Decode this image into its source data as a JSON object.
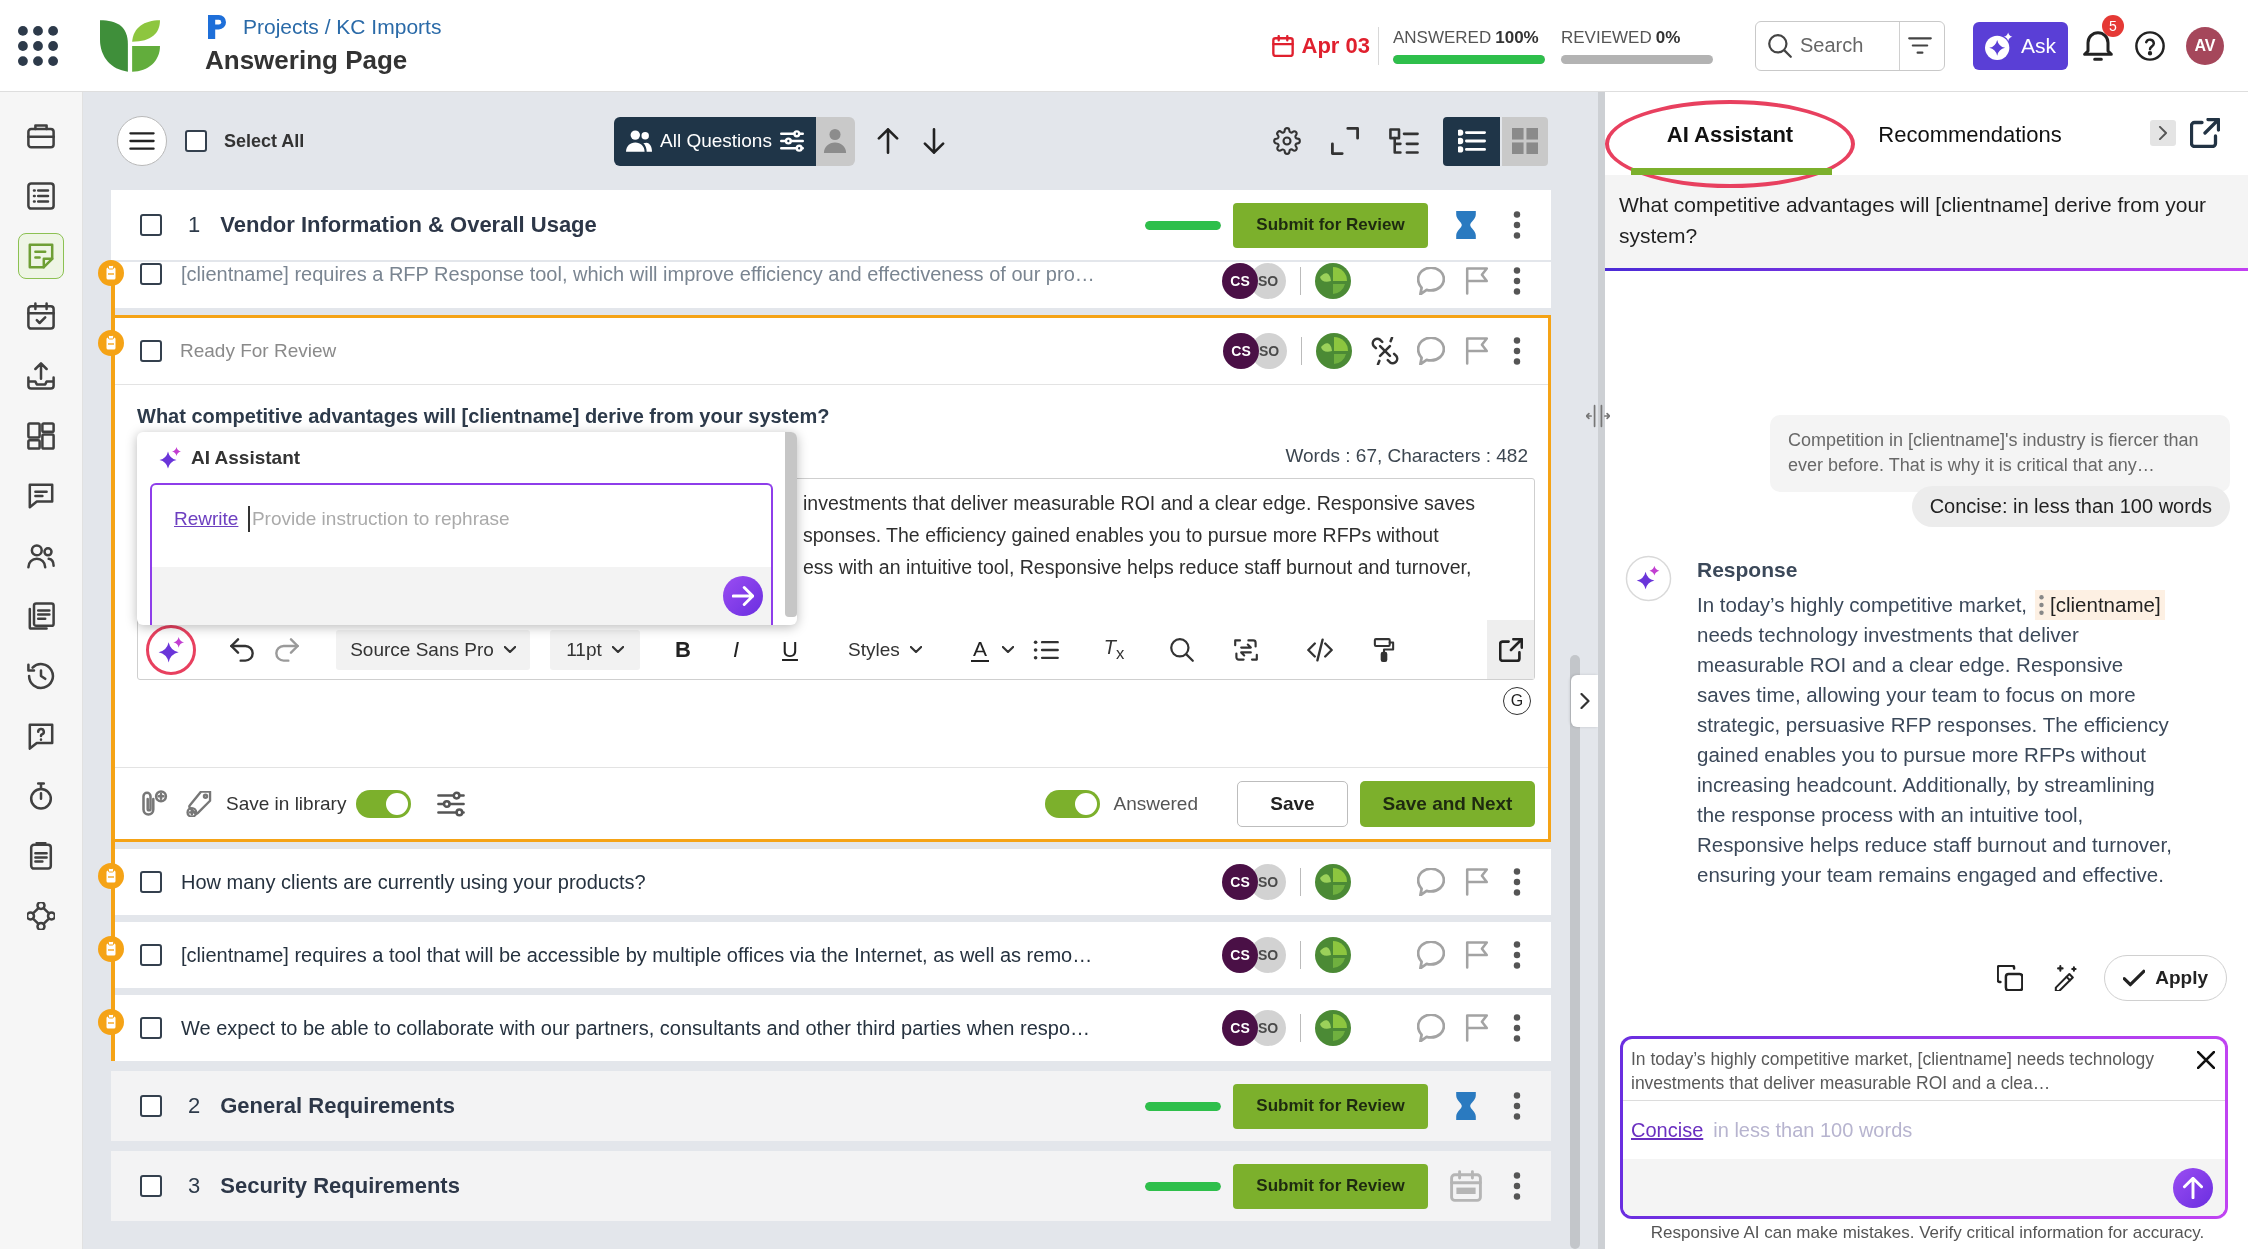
{
  "header": {
    "breadcrumb": "Projects / KC Imports",
    "title": "Answering Page",
    "due_date": "Apr 03",
    "progress": [
      {
        "label": "ANSWERED",
        "value": "100%",
        "level": 1
      },
      {
        "label": "REVIEWED",
        "value": "0%",
        "level": 0
      }
    ],
    "search": {
      "placeholder": "Search"
    },
    "ask_button": "Ask",
    "notification_count": "5",
    "avatar": "AV"
  },
  "sidebar": {
    "items": [
      {
        "selected": false
      },
      {
        "selected": false
      },
      {
        "selected": true
      },
      {
        "selected": false
      },
      {
        "selected": false
      },
      {
        "selected": false
      },
      {
        "selected": false
      },
      {
        "selected": false
      },
      {
        "selected": false
      },
      {
        "selected": false
      },
      {
        "selected": false
      },
      {
        "selected": false
      },
      {
        "selected": false
      },
      {
        "selected": false
      }
    ]
  },
  "toolbar": {
    "select_all": {
      "label": "Select All",
      "checked": false
    },
    "filter_button": "All Questions",
    "views": [
      {
        "selected": true
      },
      {
        "selected": false
      }
    ]
  },
  "sections": [
    {
      "number": "1",
      "title": "Vendor Information & Overall Usage",
      "checked": false,
      "expanded": true,
      "level": 1,
      "submit_button": "Submit for Review",
      "in_progress": true,
      "questions": [
        {
          "text": "[clientname] requires a RFP Response tool, which will improve efficiency and effectiveness of our pro…",
          "checked": false,
          "expanded": false,
          "faded": true,
          "assignees": [
            {
              "initials": "CS",
              "color": "#4a1046"
            },
            {
              "initials": "SO",
              "color": "#d2d2d2"
            }
          ]
        },
        {
          "status_label": "Ready For Review",
          "text": "What competitive advantages will [clientname] derive from your system?",
          "checked": false,
          "expanded": true,
          "faded": false,
          "assignees": [
            {
              "initials": "CS",
              "color": "#4a1046"
            },
            {
              "initials": "SO",
              "color": "#d2d2d2"
            }
          ],
          "word_count": "Words : 67, Characters : 482",
          "answer_lines": [
            "investments that deliver measurable ROI and a clear edge. Responsive saves",
            "sponses. The efficiency gained enables you to pursue more RFPs without",
            "ess with an intuitive tool, Responsive helps reduce staff burnout and turnover,"
          ],
          "editor": {
            "ai_button": {
              "highlighted": true
            },
            "font": "Source Sans Pro",
            "size": "11pt",
            "format_buttons": [
              "B",
              "I",
              "U"
            ],
            "styles": "Styles",
            "text_color": "A",
            "clear_format": "*T*$_{x}$",
            "grammar_badge": "G"
          },
          "ai_popup": {
            "title": "AI Assistant",
            "action": "Rewrite",
            "placeholder": "Provide instruction to rephrase"
          },
          "footer": {
            "save_in_library": {
              "label": "Save in library",
              "on": true
            },
            "answered": {
              "label": "Answered",
              "on": true
            },
            "buttons": [
              {
                "label": "Save",
                "kind": "secondary"
              },
              {
                "label": "Save and Next",
                "kind": "primary"
              }
            ]
          }
        },
        {
          "text": "How many clients are currently using your products?",
          "checked": false,
          "expanded": false,
          "faded": false,
          "assignees": [
            {
              "initials": "CS",
              "color": "#4a1046"
            },
            {
              "initials": "SO",
              "color": "#d2d2d2"
            }
          ]
        },
        {
          "text": "[clientname] requires a tool that will be accessible by multiple offices via the Internet, as well as remo…",
          "checked": false,
          "expanded": false,
          "faded": false,
          "assignees": [
            {
              "initials": "CS",
              "color": "#4a1046"
            },
            {
              "initials": "SO",
              "color": "#d2d2d2"
            }
          ]
        },
        {
          "text": "We expect to be able to collaborate with our partners, consultants and other third parties when respo…",
          "checked": false,
          "expanded": false,
          "faded": false,
          "assignees": [
            {
              "initials": "CS",
              "color": "#4a1046"
            },
            {
              "initials": "SO",
              "color": "#d2d2d2"
            }
          ]
        }
      ]
    },
    {
      "number": "2",
      "title": "General Requirements",
      "checked": false,
      "expanded": false,
      "level": 1,
      "submit_button": "Submit for Review",
      "in_progress": true
    },
    {
      "number": "3",
      "title": "Security Requirements",
      "checked": false,
      "expanded": false,
      "level": 1,
      "submit_button": "Submit for Review",
      "in_progress": false
    }
  ],
  "assistant_panel": {
    "tabs": [
      {
        "label": "AI Assistant",
        "selected": true,
        "highlighted": true
      },
      {
        "label": "Recommendations",
        "selected": false,
        "highlighted": false
      }
    ],
    "question": "What competitive advantages will [clientname] derive from your system?",
    "prompt": "Competition in [clientname]'s industry is fiercer than ever before. That is why it is critical that any…",
    "instruction": "Concise: in less than 100 words",
    "response": {
      "title": "Response",
      "before": "In today’s highly competitive market,",
      "token": "[clientname]",
      "after": "needs technology investments that deliver measurable ROI and a clear edge. Responsive saves time, allowing your team to focus on more strategic, persuasive RFP responses. The efficiency gained enables you to pursue more RFPs without increasing headcount. Additionally, by streamlining the response process with an intuitive tool, Responsive helps reduce staff burnout and turnover, ensuring your team remains engaged and effective."
    },
    "apply_button": "Apply",
    "composer": {
      "context": "In today’s highly competitive market, [clientname] needs technology investments that deliver measurable ROI and a clea…",
      "action": "Concise",
      "placeholder": "in less than 100 words"
    },
    "disclaimer": "Responsive AI can make mistakes. Verify critical information for accuracy."
  }
}
